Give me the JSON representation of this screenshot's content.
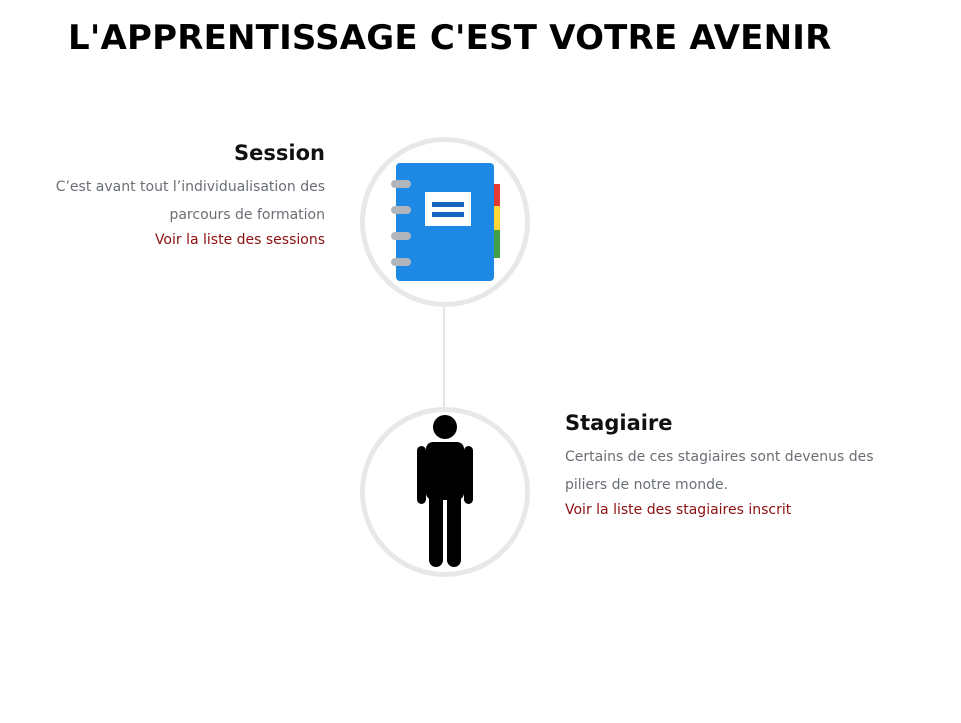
{
  "page": {
    "title": "L'APPRENTISSAGE C'EST VOTRE AVENIR"
  },
  "items": [
    {
      "title": "Session",
      "description": "C’est avant tout l’individualisation des parcours de formation",
      "link": "Voir la liste des sessions",
      "icon": "notebook-icon"
    },
    {
      "title": "Stagiaire",
      "description": "Certains de ces stagiaires sont devenus des piliers de notre monde.",
      "link": "Voir la liste des stagiaires inscrit",
      "icon": "person-icon"
    }
  ],
  "colors": {
    "link": "#8b1010",
    "description": "#6a6f75",
    "circle_border": "#e7e8ea",
    "notebook_blue": "#1e88e5"
  }
}
